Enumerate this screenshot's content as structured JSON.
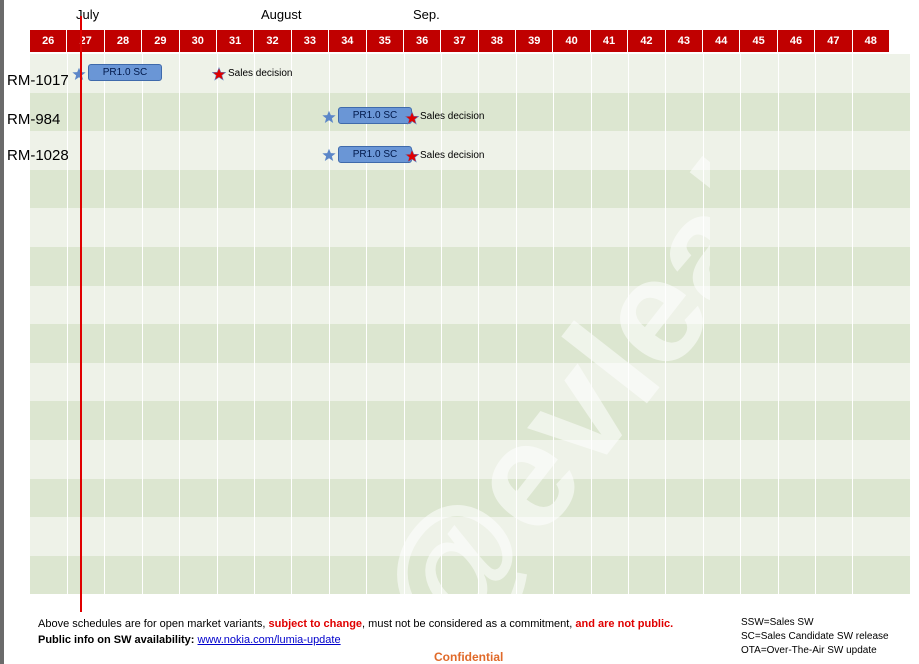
{
  "months": [
    {
      "label": "July"
    },
    {
      "label": "August"
    },
    {
      "label": "Sep."
    }
  ],
  "weeks": [
    "26",
    "27",
    "28",
    "29",
    "30",
    "31",
    "32",
    "33",
    "34",
    "35",
    "36",
    "37",
    "38",
    "39",
    "40",
    "41",
    "42",
    "43",
    "44",
    "45",
    "46",
    "47",
    "48"
  ],
  "models": [
    {
      "name": "RM-1017",
      "bar_label": "PR1.0 SC",
      "milestone_label": "Sales decision"
    },
    {
      "name": "RM-984",
      "bar_label": "PR1.0 SC",
      "milestone_label": "Sales decision"
    },
    {
      "name": "RM-1028",
      "bar_label": "PR1.0 SC",
      "milestone_label": "Sales decision"
    }
  ],
  "watermark": "@evleaks",
  "footer": {
    "line1_part1": "Above schedules are for open market variants, ",
    "line1_red1": "subject to change",
    "line1_part2": ", must not be considered as a commitment, ",
    "line1_red2": "and are not public.",
    "line2_label": "Public info on SW availability:",
    "line2_link": "www.nokia.com/lumia-update"
  },
  "legend": [
    "SSW=Sales SW",
    "SC=Sales Candidate SW release",
    "OTA=Over-The-Air SW update"
  ],
  "confidential": "Confidential",
  "colors": {
    "header_red": "#c00000",
    "bar_blue": "#6a96d6",
    "today_line": "#e00000",
    "star_blue": "#5b86c8",
    "star_red": "#e00000",
    "confidential_orange": "#e06a2a"
  }
}
